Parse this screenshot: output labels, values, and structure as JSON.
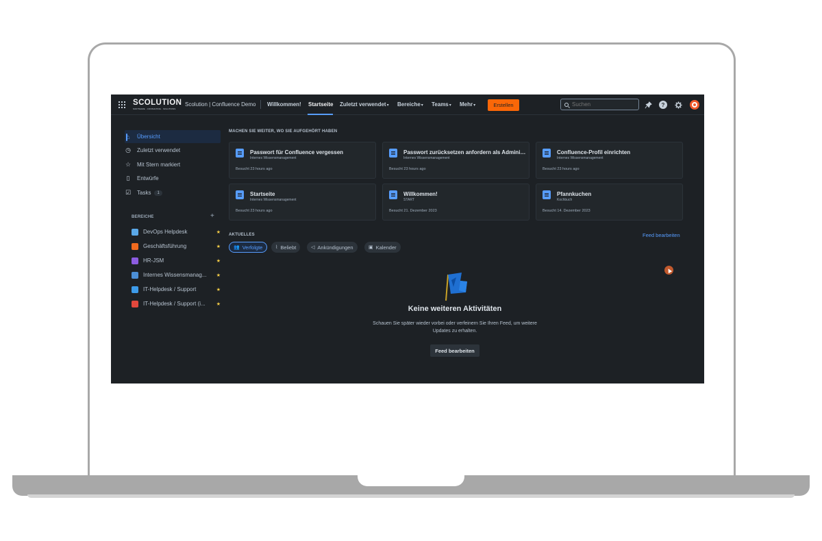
{
  "topnav": {
    "logo_text": "SCOLUTION",
    "logo_tagline": "SOFTWARE · CONSULTING · SOLUTIONS",
    "site_name": "Scolution | Confluence Demo",
    "items": [
      {
        "label": "Willkommen!"
      },
      {
        "label": "Startseite"
      },
      {
        "label": "Zuletzt verwendet"
      },
      {
        "label": "Bereiche"
      },
      {
        "label": "Teams"
      },
      {
        "label": "Mehr"
      }
    ],
    "create_label": "Erstellen",
    "search_placeholder": "Suchen",
    "icons": [
      "apps-grid-icon",
      "notifications-icon",
      "help-icon",
      "settings-icon",
      "avatar"
    ],
    "accent": "#579dff",
    "create_color": "#fa6708"
  },
  "sidebar": {
    "items": [
      {
        "label": "Übersicht",
        "icon": "home-icon"
      },
      {
        "label": "Zuletzt verwendet",
        "icon": "clock-icon"
      },
      {
        "label": "Mit Stern markiert",
        "icon": "star-outline-icon"
      },
      {
        "label": "Entwürfe",
        "icon": "draft-icon"
      },
      {
        "label": "Tasks",
        "icon": "checkbox-icon",
        "badge": "1"
      }
    ],
    "spaces_label": "BEREICHE",
    "add_icon": "plus-icon",
    "spaces": [
      {
        "label": "DevOps Helpdesk",
        "color": "#5aa8e8"
      },
      {
        "label": "Geschäftsführung",
        "color": "#f06a1e"
      },
      {
        "label": "HR-JSM",
        "color": "#8c5ce0"
      },
      {
        "label": "Internes Wissensmanag...",
        "color": "#4c8fd6"
      },
      {
        "label": "IT-Helpdesk / Support",
        "color": "#3d9be9"
      },
      {
        "label": "IT-Helpdesk / Support (i...",
        "color": "#e2483d"
      }
    ]
  },
  "main": {
    "continue_label": "MACHEN SIE WEITER, WO SIE AUFGEHÖRT HABEN",
    "cards": [
      {
        "title": "Passwort für Confluence vergessen",
        "space": "Internes Wissensmanagement",
        "meta": "Besucht 23 hours ago"
      },
      {
        "title": "Passwort zurücksetzen anfordern als Adminis...",
        "space": "Internes Wissensmanagement",
        "meta": "Besucht 23 hours ago"
      },
      {
        "title": "Confluence-Profil einrichten",
        "space": "Internes Wissensmanagement",
        "meta": "Besucht 23 hours ago"
      },
      {
        "title": "Startseite",
        "space": "Internes Wissensmanagement",
        "meta": "Besucht 23 hours ago"
      },
      {
        "title": "Willkommen!",
        "space": "START",
        "meta": "Besucht 21. Dezember 2023"
      },
      {
        "title": "Pfannkuchen",
        "space": "Kochbuch",
        "meta": "Besucht 14. Dezember 2023"
      }
    ],
    "activity_label": "AKTUELLES",
    "feed_edit_link": "Feed bearbeiten",
    "tabs": [
      {
        "label": "Verfolgte",
        "icon": "people-icon"
      },
      {
        "label": "Beliebt",
        "icon": "chart-icon"
      },
      {
        "label": "Ankündigungen",
        "icon": "megaphone-icon"
      },
      {
        "label": "Kalender",
        "icon": "calendar-icon"
      }
    ],
    "empty": {
      "title": "Keine weiteren Aktivitäten",
      "description": "Schauen Sie später wieder vorbei oder verfeinern Sie Ihren Feed, um weitere Updates zu erhalten.",
      "button_label": "Feed bearbeiten",
      "illustration": "flag-icon"
    }
  }
}
